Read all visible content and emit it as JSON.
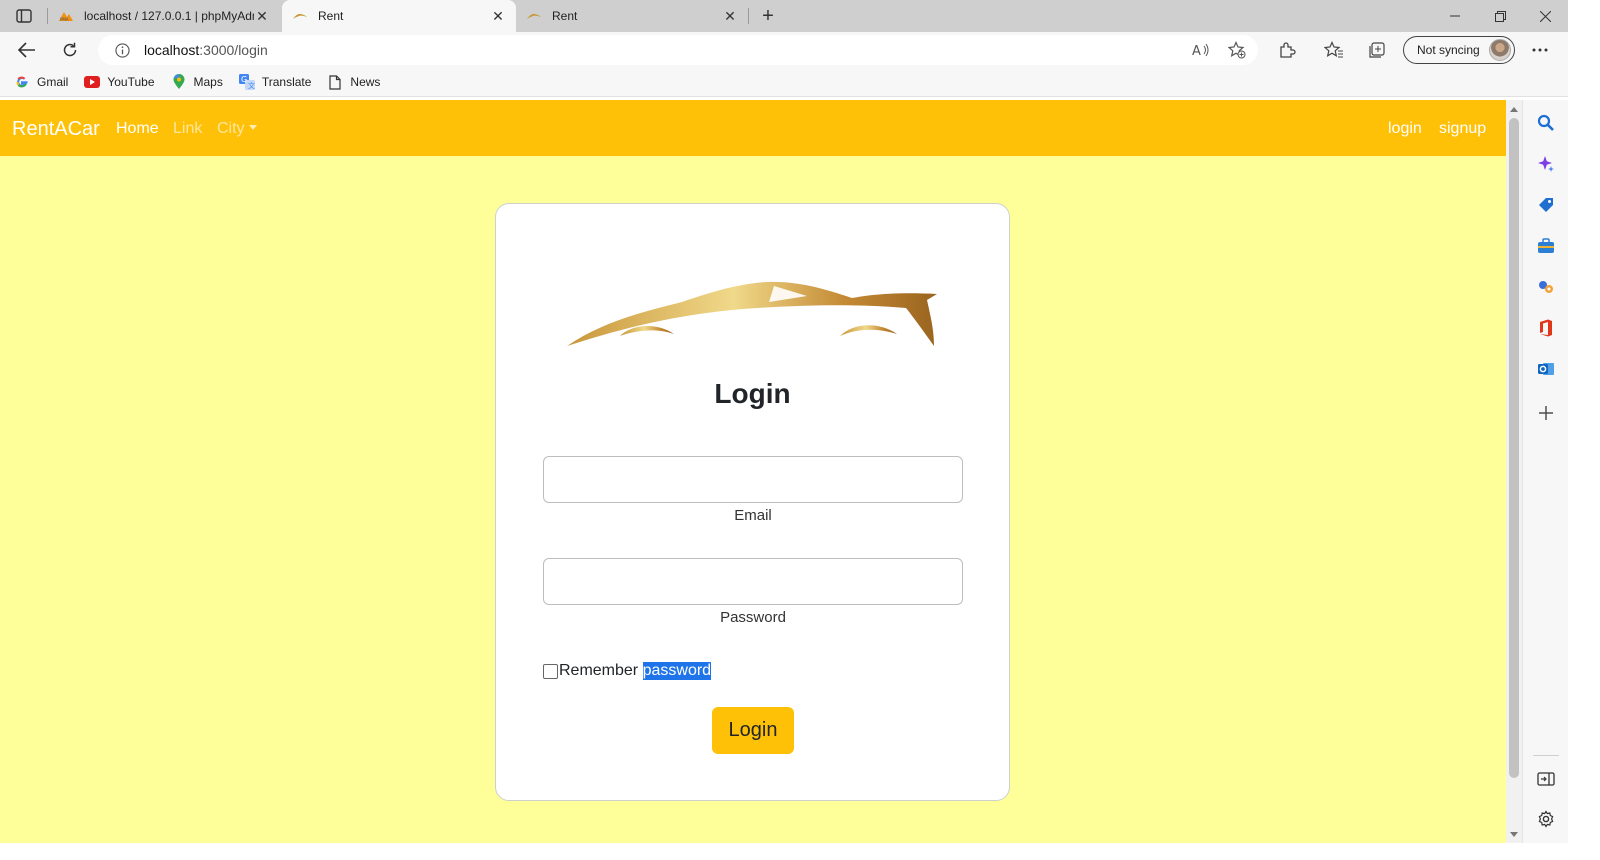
{
  "browser": {
    "tabs": [
      {
        "title": "localhost / 127.0.0.1 | phpMyAdmin",
        "favicon": "phpmyadmin-icon"
      },
      {
        "title": "Rent",
        "favicon": "car-logo-icon"
      },
      {
        "title": "Rent",
        "favicon": "car-logo-icon"
      }
    ],
    "url_host": "localhost",
    "url_path": ":3000/login",
    "sync_label": "Not syncing",
    "bookmarks": [
      {
        "label": "Gmail",
        "icon": "google-icon"
      },
      {
        "label": "YouTube",
        "icon": "youtube-icon"
      },
      {
        "label": "Maps",
        "icon": "maps-pin-icon"
      },
      {
        "label": "Translate",
        "icon": "translate-icon"
      },
      {
        "label": "News",
        "icon": "page-icon"
      }
    ]
  },
  "app": {
    "brand": "RentACar",
    "nav": {
      "home": "Home",
      "link": "Link",
      "city": "City",
      "login": "login",
      "signup": "signup"
    },
    "form": {
      "title": "Login",
      "email_label": "Email",
      "email_value": "",
      "password_label": "Password",
      "password_value": "",
      "remember_word": "Remember",
      "remember_selected": "password",
      "submit": "Login"
    }
  },
  "colors": {
    "navbar": "#ffc107",
    "page_bg": "#ffff99",
    "button": "#ffc107",
    "selection": "#1e74e8"
  }
}
